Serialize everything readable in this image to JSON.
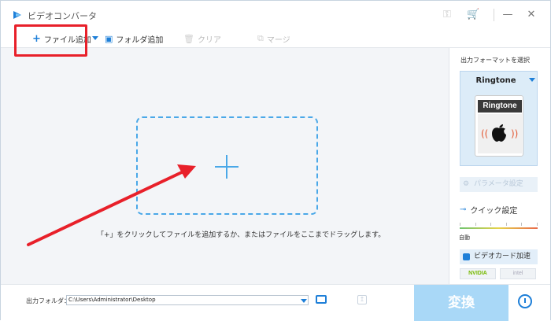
{
  "window": {
    "title": "ビデオコンバータ"
  },
  "toolbar": {
    "add_file": "ファイル追加",
    "add_folder": "フォルダ追加",
    "clear": "クリア",
    "merge": "マージ"
  },
  "main": {
    "hint": "「+」をクリックしてファイルを追加するか、またはファイルをここまでドラッグします。"
  },
  "right_panel": {
    "title": "出力フォーマットを選択",
    "format": "Ringtone",
    "format_image_label": "Ringtone",
    "params_button": "パラメータ設定",
    "quick_settings": "クイック設定",
    "quick_level": "自動",
    "gpu_button": "ビデオカード加速",
    "vendor_nvidia": "NVIDIA",
    "vendor_intel": "intel"
  },
  "bottom": {
    "output_label": "出力フォルダ：",
    "output_path": "C:\\Users\\Administrator\\Desktop",
    "convert_label": "変換"
  },
  "colors": {
    "accent": "#1e7fd8",
    "highlight": "#e8202a",
    "drop_border": "#4aa8e8",
    "convert_bg": "#a9d8f7"
  }
}
